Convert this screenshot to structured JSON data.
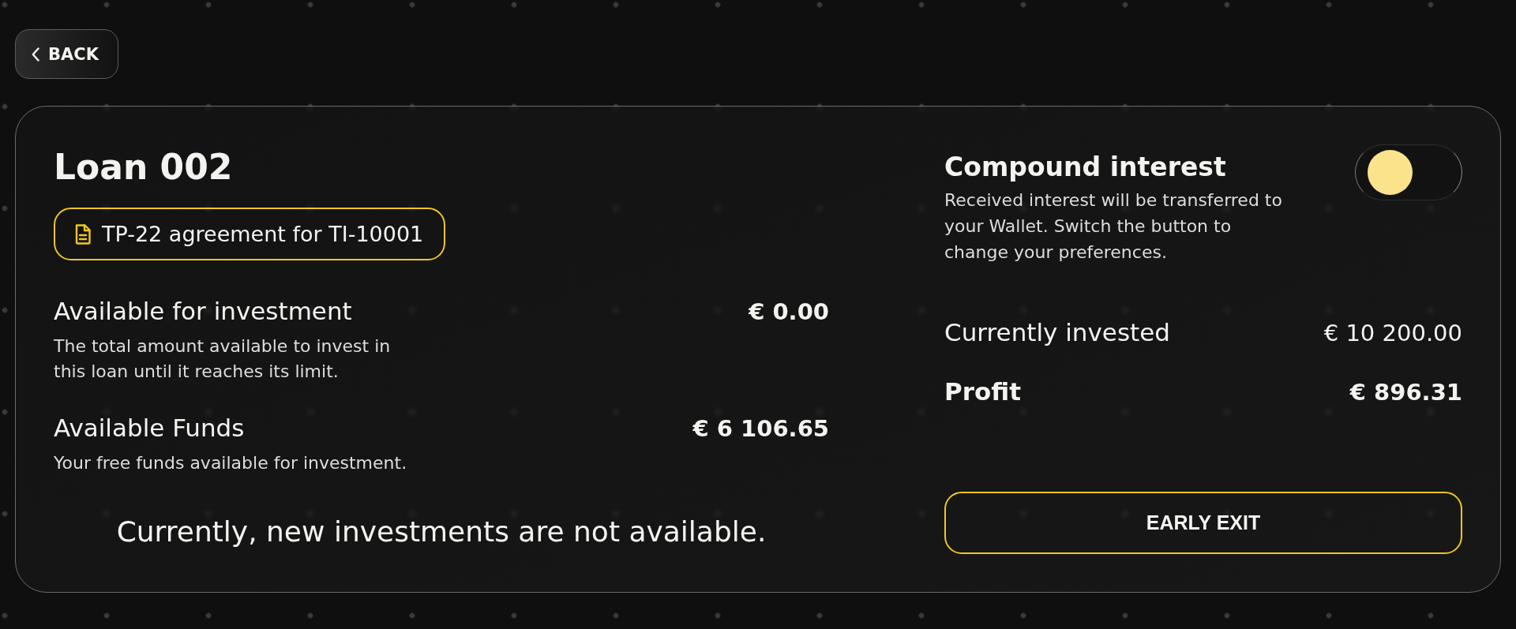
{
  "back_button": {
    "label": "BACK"
  },
  "loan": {
    "title": "Loan 002",
    "agreement": {
      "label": "TP-22 agreement for TI-10001"
    },
    "metrics": [
      {
        "label": "Available for investment",
        "value": "€ 0.00",
        "description": "The total amount available to invest in this loan until it reaches its limit."
      },
      {
        "label": "Available Funds",
        "value": "€ 6 106.65",
        "description": "Your free funds available for investment."
      }
    ],
    "notice": "Currently, new investments are not available."
  },
  "compound_interest": {
    "title": "Compound interest",
    "on": false,
    "description": "Received interest will be transferred to your Wallet. Switch the button to change your preferences."
  },
  "investment": [
    {
      "label": "Currently invested",
      "value": "€ 10 200.00",
      "emphasized": false
    },
    {
      "label": "Profit",
      "value": "€ 896.31",
      "emphasized": true
    }
  ],
  "early_exit_button": {
    "label": "EARLY EXIT"
  }
}
